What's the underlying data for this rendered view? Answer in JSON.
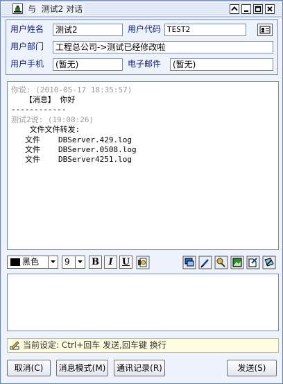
{
  "titlebar": {
    "title": "与  测试2 对话"
  },
  "info": {
    "user_name_label": "用户姓名",
    "user_name_value": "测试2",
    "user_code_label": "用户代码",
    "user_code_value": "TEST2",
    "department_label": "用户部门",
    "department_value": "工程总公司->测试已经修改啦",
    "mobile_label": "用户手机",
    "mobile_value": "(暂无)",
    "email_label": "电子邮件",
    "email_value": "(暂无)"
  },
  "chat": {
    "msg1_header": "你说: (2010-05-17 18:35:57)",
    "msg1_body": "   【消息】 你好",
    "separator": "------------",
    "msg2_header": "测试2说: (19:08:26)",
    "msg2_body": "    文件文件转发:",
    "files": [
      {
        "kind": "文件",
        "name": "DBServer.429.log"
      },
      {
        "kind": "文件",
        "name": "DBServer.0508.log"
      },
      {
        "kind": "文件",
        "name": "DBServer4251.log"
      }
    ]
  },
  "toolbar": {
    "color_label": "黑色",
    "font_size": "9",
    "bold": "B",
    "italic": "I",
    "underline": "U"
  },
  "status": {
    "text": "当前设定: Ctrl+回车 发送,回车键 换行"
  },
  "buttons": {
    "cancel": "取消(C)",
    "mode": "消息模式(M)",
    "history": "通讯记录(R)",
    "send": "发送(S)"
  },
  "colors": {
    "frame": "#6a7fb3",
    "panel": "#eef2fa",
    "label": "#10208a",
    "status_bg": "#fffde0"
  }
}
